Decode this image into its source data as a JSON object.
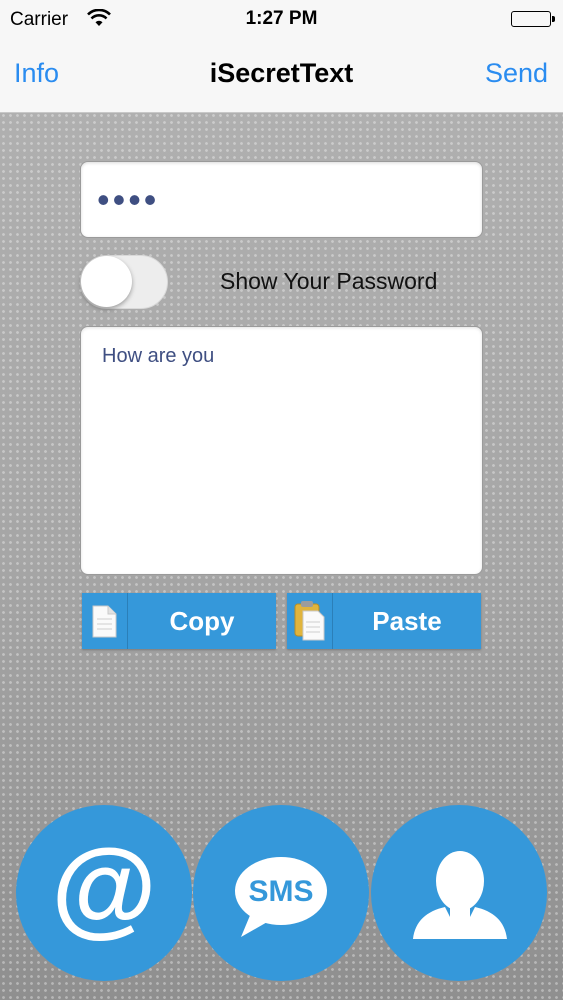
{
  "status_bar": {
    "carrier": "Carrier",
    "time": "1:27 PM",
    "icons": [
      "wifi-icon",
      "battery-icon"
    ]
  },
  "nav": {
    "info_label": "Info",
    "title": "iSecretText",
    "send_label": "Send"
  },
  "password": {
    "masked_value": "••••"
  },
  "show_password": {
    "label": "Show Your Password",
    "on": false
  },
  "message": {
    "text": "How are you"
  },
  "actions": {
    "copy_label": "Copy",
    "copy_icon": "document-icon",
    "paste_label": "Paste",
    "paste_icon": "clipboard-icon"
  },
  "share": {
    "email_glyph": "@",
    "email_icon": "email-icon",
    "sms_text": "SMS",
    "sms_icon": "sms-bubble-icon",
    "contact_icon": "contact-person-icon"
  },
  "colors": {
    "accent": "#3598da",
    "nav_link": "#2a8cf0",
    "text_input": "#3f4f82"
  }
}
